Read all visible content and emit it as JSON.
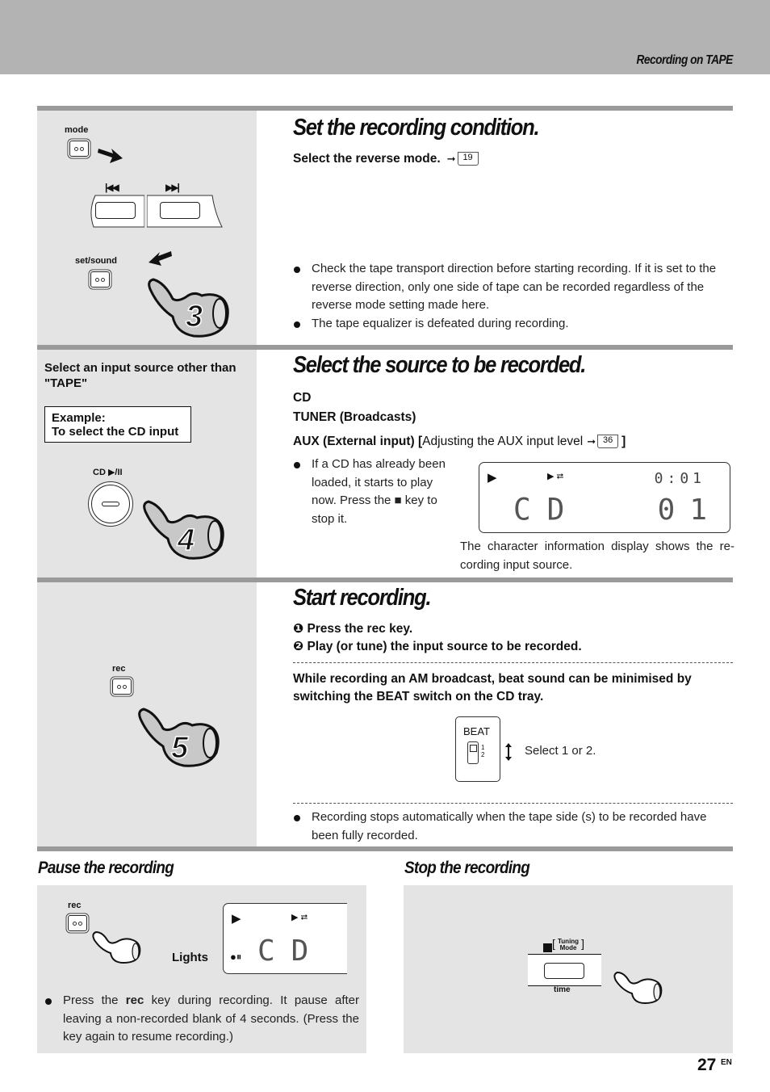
{
  "header": {
    "section_title": "Recording on TAPE"
  },
  "step3": {
    "number": "3",
    "title": "Set the recording condition.",
    "instruction": "Select the reverse mode.",
    "ref_page": "19",
    "keys": {
      "mode": "mode",
      "set_sound": "set/sound",
      "prev_symbol": "|◀◀",
      "next_symbol": "▶▶|"
    },
    "notes": [
      "Check the tape transport direction before starting recording. If it is set to the reverse direction, only one side of tape can be recorded regardless of the reverse mode setting made here.",
      "The tape equalizer is defeated during recording."
    ]
  },
  "step4": {
    "number": "4",
    "title": "Select the source to be recorded.",
    "left_heading": "Select an input source other than \"TAPE\"",
    "example_line1": "Example:",
    "example_line2": "To select the CD input",
    "cd_key_label": "CD ▶/II",
    "sources": {
      "cd": "CD",
      "tuner": "TUNER (Broadcasts)",
      "aux_bold": "AUX (External input) [",
      "aux_normal": "Adjusting the AUX input level",
      "aux_ref_page": "36",
      "aux_close": "]"
    },
    "note": "If a CD has already been loaded, it starts to play now. Press the ■ key to stop it.",
    "display": {
      "top_time": "0:01",
      "source": "CD",
      "track": "01"
    },
    "display_caption": "The character information display shows the re-cording input source."
  },
  "step5": {
    "number": "5",
    "title": "Start recording.",
    "rec_key_label": "rec",
    "steps": [
      {
        "marker": "❶",
        "text": "Press the rec key."
      },
      {
        "marker": "❷",
        "text": "Play (or tune) the input source to be recorded."
      }
    ],
    "beat_note": "While recording an AM broadcast, beat sound can be minimised by switching the BEAT switch on the CD tray.",
    "beat_switch": {
      "label": "BEAT",
      "pos1": "1",
      "pos2": "2",
      "instruction": "Select 1 or 2."
    },
    "note": "Recording stops automatically when the tape side (s) to be recorded have been fully recorded."
  },
  "pause": {
    "title": "Pause the recording",
    "rec_key_label": "rec",
    "lights_label": "Lights",
    "display_source": "CD",
    "note_pre": "Press the",
    "note_bold": "rec",
    "note_post": "key during recording. It pause after leaving a non-recorded blank of 4 seconds. (Press the key again to resume recording.)"
  },
  "stop": {
    "title": "Stop the recording",
    "key_line1": "Tuning",
    "key_line2": "Mode",
    "key_bottom_label": "time"
  },
  "footer": {
    "page_number": "27",
    "language": "EN"
  }
}
